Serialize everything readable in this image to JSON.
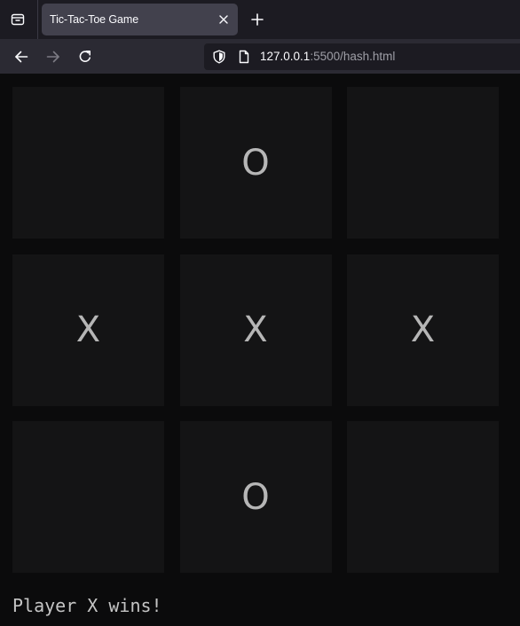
{
  "browser": {
    "tab": {
      "title": "Tic-Tac-Toe Game"
    },
    "address_bar": {
      "host": "127.0.0.1",
      "rest": ":5500/hash.html"
    },
    "icons": {
      "tab_list": "tab-list-icon",
      "close_tab": "close-icon",
      "new_tab": "plus-icon",
      "back": "arrow-left-icon",
      "forward": "arrow-right-icon",
      "reload": "reload-icon",
      "tracking_protection": "shield-icon",
      "page_info": "page-icon"
    }
  },
  "game": {
    "board": [
      [
        "",
        "O",
        ""
      ],
      [
        "X",
        "X",
        "X"
      ],
      [
        "",
        "O",
        ""
      ]
    ],
    "status": "Player X wins!"
  },
  "colors": {
    "page_background": "#0b0b0c",
    "cell_background": "#141415",
    "mark": "#b6b6b6",
    "tab_strip": "#1c1b22",
    "toolbar": "#2b2a33",
    "active_tab": "#42414d"
  }
}
